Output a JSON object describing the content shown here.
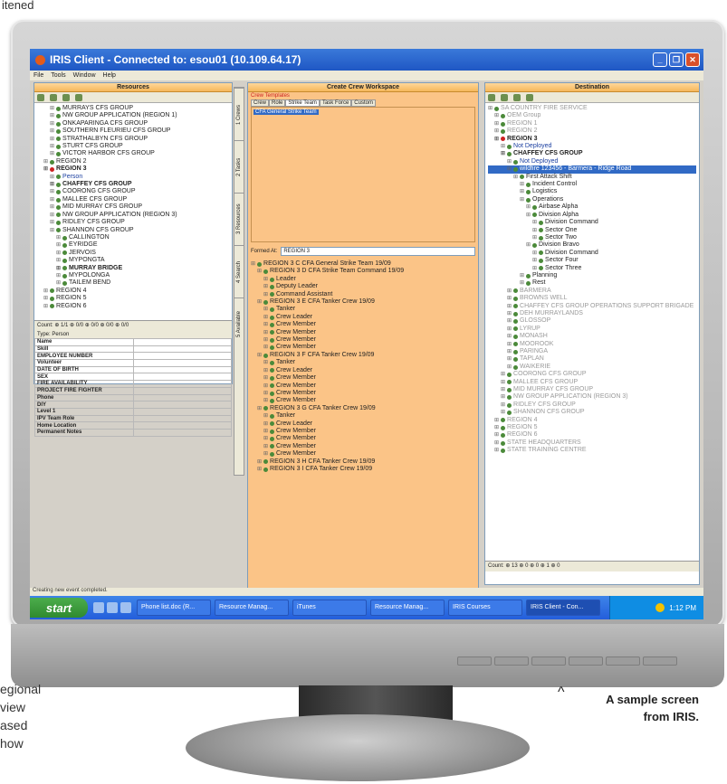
{
  "captions": {
    "top_fragment": "itened",
    "left_lines": [
      "egional",
      "view",
      "ased",
      "how"
    ],
    "right_mark": "^",
    "right_lines": [
      "A sample screen",
      "from IRIS."
    ]
  },
  "window": {
    "title": "IRIS Client - Connected to: esou01 (10.109.64.17)"
  },
  "menu": [
    "File",
    "Tools",
    "Window",
    "Help"
  ],
  "resources": {
    "header": "Resources",
    "tree": [
      {
        "t": "MURRAYS CFS GROUP",
        "d": 2
      },
      {
        "t": "NW GROUP APPLICATION (REGION 1)",
        "d": 2
      },
      {
        "t": "ONKAPARINGA CFS GROUP",
        "d": 2
      },
      {
        "t": "SOUTHERN FLEURIEU CFS GROUP",
        "d": 2
      },
      {
        "t": "STRATHALBYN CFS GROUP",
        "d": 2
      },
      {
        "t": "STURT CFS GROUP",
        "d": 2
      },
      {
        "t": "VICTOR HARBOR CFS GROUP",
        "d": 2
      },
      {
        "t": "REGION 2",
        "d": 1
      },
      {
        "t": "REGION 3",
        "d": 1,
        "c": "red bold"
      },
      {
        "t": "Person",
        "d": 2,
        "c": "blue"
      },
      {
        "t": "CHAFFEY CFS GROUP",
        "d": 2,
        "c": "bold"
      },
      {
        "t": "COORONG CFS GROUP",
        "d": 2
      },
      {
        "t": "MALLEE CFS GROUP",
        "d": 2
      },
      {
        "t": "MID MURRAY CFS GROUP",
        "d": 2
      },
      {
        "t": "NW GROUP APPLICATION (REGION 3)",
        "d": 2
      },
      {
        "t": "RIDLEY CFS GROUP",
        "d": 2
      },
      {
        "t": "SHANNON CFS GROUP",
        "d": 2
      },
      {
        "t": "CALLINGTON",
        "d": 3
      },
      {
        "t": "EYRIDGE",
        "d": 3
      },
      {
        "t": "JERVOIS",
        "d": 3
      },
      {
        "t": "MYPONGTA",
        "d": 3
      },
      {
        "t": "MURRAY BRIDGE",
        "d": 3,
        "c": "bold"
      },
      {
        "t": "MYPOLONGA",
        "d": 3
      },
      {
        "t": "TAILEM BEND",
        "d": 3
      },
      {
        "t": "REGION 4",
        "d": 1
      },
      {
        "t": "REGION 5",
        "d": 1
      },
      {
        "t": "REGION 6",
        "d": 1
      }
    ],
    "count": "Count: ⊕ 1/1 ⊕ 0/0 ⊕ 0/0 ⊕ 0/0 ⊕ 0/0",
    "form": {
      "type_label": "Type: Person",
      "fields": [
        "Name",
        "Skill",
        "EMPLOYEE NUMBER",
        "Volunteer",
        "DATE OF BIRTH",
        "SEX",
        "FIRE AVAILABILITY",
        "PROJECT FIRE FIGHTER",
        "Phone",
        "DIY",
        "Level 1",
        "IPV Team Role",
        "Home Location",
        "Permanent Notes"
      ]
    }
  },
  "vertical_tabs": [
    "1 Crews",
    "2 Tasks",
    "3 Resources",
    "4 Search",
    "5 Available"
  ],
  "workspace": {
    "header": "Create Crew Workspace",
    "templates_label": "Crew Templates",
    "tabs": [
      "Crew",
      "Role",
      "Strike Team",
      "Task Force",
      "Custom"
    ],
    "template_item": "CFA General Strike Team",
    "formed_at_label": "Formed At:",
    "formed_at_value": "REGION 3",
    "tree": [
      {
        "t": "REGION 3 C CFA General Strike Team 19/09",
        "d": 0
      },
      {
        "t": "REGION 3 D CFA Strike Team Command 19/09",
        "d": 1
      },
      {
        "t": "Leader",
        "d": 2
      },
      {
        "t": "Deputy Leader",
        "d": 2
      },
      {
        "t": "Command Assistant",
        "d": 2
      },
      {
        "t": "REGION 3 E CFA Tanker Crew 19/09",
        "d": 1
      },
      {
        "t": "Tanker",
        "d": 2
      },
      {
        "t": "Crew Leader",
        "d": 2
      },
      {
        "t": "Crew Member",
        "d": 2
      },
      {
        "t": "Crew Member",
        "d": 2
      },
      {
        "t": "Crew Member",
        "d": 2
      },
      {
        "t": "Crew Member",
        "d": 2
      },
      {
        "t": "REGION 3 F CFA Tanker Crew 19/09",
        "d": 1
      },
      {
        "t": "Tanker",
        "d": 2
      },
      {
        "t": "Crew Leader",
        "d": 2
      },
      {
        "t": "Crew Member",
        "d": 2
      },
      {
        "t": "Crew Member",
        "d": 2
      },
      {
        "t": "Crew Member",
        "d": 2
      },
      {
        "t": "Crew Member",
        "d": 2
      },
      {
        "t": "REGION 3 G CFA Tanker Crew 19/09",
        "d": 1
      },
      {
        "t": "Tanker",
        "d": 2
      },
      {
        "t": "Crew Leader",
        "d": 2
      },
      {
        "t": "Crew Member",
        "d": 2
      },
      {
        "t": "Crew Member",
        "d": 2
      },
      {
        "t": "Crew Member",
        "d": 2
      },
      {
        "t": "Crew Member",
        "d": 2
      },
      {
        "t": "REGION 3 H CFA Tanker Crew 19/09",
        "d": 1
      },
      {
        "t": "REGION 3 I CFA Tanker Crew 19/09",
        "d": 1
      }
    ]
  },
  "destination": {
    "header": "Destination",
    "tree": [
      {
        "t": "SA COUNTRY FIRE SERVICE",
        "d": 0,
        "c": "gray"
      },
      {
        "t": "OEM Group",
        "d": 1,
        "c": "gray"
      },
      {
        "t": "REGION 1",
        "d": 1,
        "c": "gray"
      },
      {
        "t": "REGION 2",
        "d": 1,
        "c": "gray"
      },
      {
        "t": "REGION 3",
        "d": 1,
        "c": "red bold"
      },
      {
        "t": "Not Deployed",
        "d": 2,
        "c": "blue"
      },
      {
        "t": "CHAFFEY CFS GROUP",
        "d": 2,
        "c": "bold"
      },
      {
        "t": "Not Deployed",
        "d": 3,
        "c": "blue"
      },
      {
        "t": "wildfire 123456 - Barmera - Ridge Road",
        "d": 3,
        "c": "sel"
      },
      {
        "t": "First Attack Shift",
        "d": 4
      },
      {
        "t": "Incident Control",
        "d": 5
      },
      {
        "t": "Logistics",
        "d": 5
      },
      {
        "t": "Operations",
        "d": 5
      },
      {
        "t": "Airbase Alpha",
        "d": 6
      },
      {
        "t": "Division Alpha",
        "d": 6
      },
      {
        "t": "Division Command",
        "d": 7
      },
      {
        "t": "Sector One",
        "d": 7
      },
      {
        "t": "Sector Two",
        "d": 7
      },
      {
        "t": "Division Bravo",
        "d": 6
      },
      {
        "t": "Division Command",
        "d": 7
      },
      {
        "t": "Sector Four",
        "d": 7
      },
      {
        "t": "Sector Three",
        "d": 7
      },
      {
        "t": "Planning",
        "d": 5
      },
      {
        "t": "Rest",
        "d": 5
      },
      {
        "t": "BARMERA",
        "d": 3,
        "c": "gray"
      },
      {
        "t": "BROWNS WELL",
        "d": 3,
        "c": "gray"
      },
      {
        "t": "CHAFFEY CFS GROUP OPERATIONS SUPPORT BRIGADE",
        "d": 3,
        "c": "gray"
      },
      {
        "t": "DEH MURRAYLANDS",
        "d": 3,
        "c": "gray"
      },
      {
        "t": "GLOSSOP",
        "d": 3,
        "c": "gray"
      },
      {
        "t": "LYRUP",
        "d": 3,
        "c": "gray"
      },
      {
        "t": "MONASH",
        "d": 3,
        "c": "gray"
      },
      {
        "t": "MOOROOK",
        "d": 3,
        "c": "gray"
      },
      {
        "t": "PARINGA",
        "d": 3,
        "c": "gray"
      },
      {
        "t": "TAPLAN",
        "d": 3,
        "c": "gray"
      },
      {
        "t": "WAIKERIE",
        "d": 3,
        "c": "gray"
      },
      {
        "t": "COORONG CFS GROUP",
        "d": 2,
        "c": "gray"
      },
      {
        "t": "MALLEE CFS GROUP",
        "d": 2,
        "c": "gray"
      },
      {
        "t": "MID MURRAY CFS GROUP",
        "d": 2,
        "c": "gray"
      },
      {
        "t": "NW GROUP APPLICATION (REGION 3)",
        "d": 2,
        "c": "gray"
      },
      {
        "t": "RIDLEY CFS GROUP",
        "d": 2,
        "c": "gray"
      },
      {
        "t": "SHANNON CFS GROUP",
        "d": 2,
        "c": "gray"
      },
      {
        "t": "REGION 4",
        "d": 1,
        "c": "gray"
      },
      {
        "t": "REGION 5",
        "d": 1,
        "c": "gray"
      },
      {
        "t": "REGION 6",
        "d": 1,
        "c": "gray"
      },
      {
        "t": "STATE HEADQUARTERS",
        "d": 1,
        "c": "gray"
      },
      {
        "t": "STATE TRAINING CENTRE",
        "d": 1,
        "c": "gray"
      }
    ],
    "count": "Count: ⊕ 13 ⊕ 0 ⊕ 0 ⊕ 1 ⊕ 0"
  },
  "status_text": "Creating new event completed.",
  "taskbar": {
    "start": "start",
    "tasks": [
      "Phone list.doc (R...",
      "Resource Manag...",
      "iTunes",
      "Resource Manag...",
      "IRIS Courses",
      "IRIS Client - Con..."
    ],
    "clock": "1:12 PM"
  }
}
